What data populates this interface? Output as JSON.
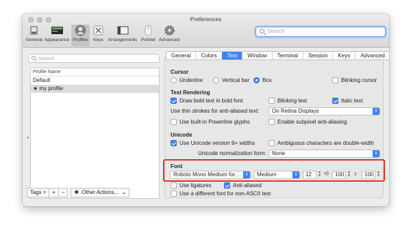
{
  "window": {
    "title": "Preferences"
  },
  "toolbar": {
    "items": [
      {
        "label": "General"
      },
      {
        "label": "Appearance"
      },
      {
        "label": "Profiles"
      },
      {
        "label": "Keys"
      },
      {
        "label": "Arrangements"
      },
      {
        "label": "Pointer"
      },
      {
        "label": "Advanced"
      }
    ],
    "search_placeholder": "Search"
  },
  "profiles": {
    "search_placeholder": "Search",
    "column_header": "Profile Name",
    "rows": [
      "Default",
      "★ my profile"
    ],
    "tags_label": "Tags >",
    "add_label": "+",
    "remove_label": "−",
    "other_actions_label": "Other Actions..."
  },
  "tabs": [
    "General",
    "Colors",
    "Text",
    "Window",
    "Terminal",
    "Session",
    "Keys",
    "Advanced"
  ],
  "active_tab": "Text",
  "cursor": {
    "title": "Cursor",
    "underline": "Underline",
    "vertical_bar": "Vertical bar",
    "box": "Box",
    "blinking": "Blinking cursor"
  },
  "text_rendering": {
    "title": "Text Rendering",
    "draw_bold": "Draw bold text in bold font",
    "blinking_text": "Blinking text",
    "italic_text": "Italic text",
    "thin_strokes_label": "Use thin strokes for anti-aliased text:",
    "thin_strokes_value": "On Retina Displays",
    "powerline": "Use built-in Powerline glyphs",
    "subpixel": "Enable subpixel anti-aliasing"
  },
  "unicode": {
    "title": "Unicode",
    "version": "Use Unicode version 9+ widths",
    "ambiguous": "Ambiguous characters are double-width",
    "normalization_label": "Unicode normalization form:",
    "normalization_value": "None"
  },
  "font": {
    "title": "Font",
    "family": "Roboto Mono Medium for...",
    "weight": "Medium",
    "size": "12",
    "hspacing": "100",
    "vspacing": "100",
    "ligatures": "Use ligatures",
    "anti_aliased": "Anti-aliased",
    "non_ascii": "Use a different font for non-ASCII text"
  },
  "highlight_color": "#e6321d",
  "accent_color": "#3f83f2"
}
